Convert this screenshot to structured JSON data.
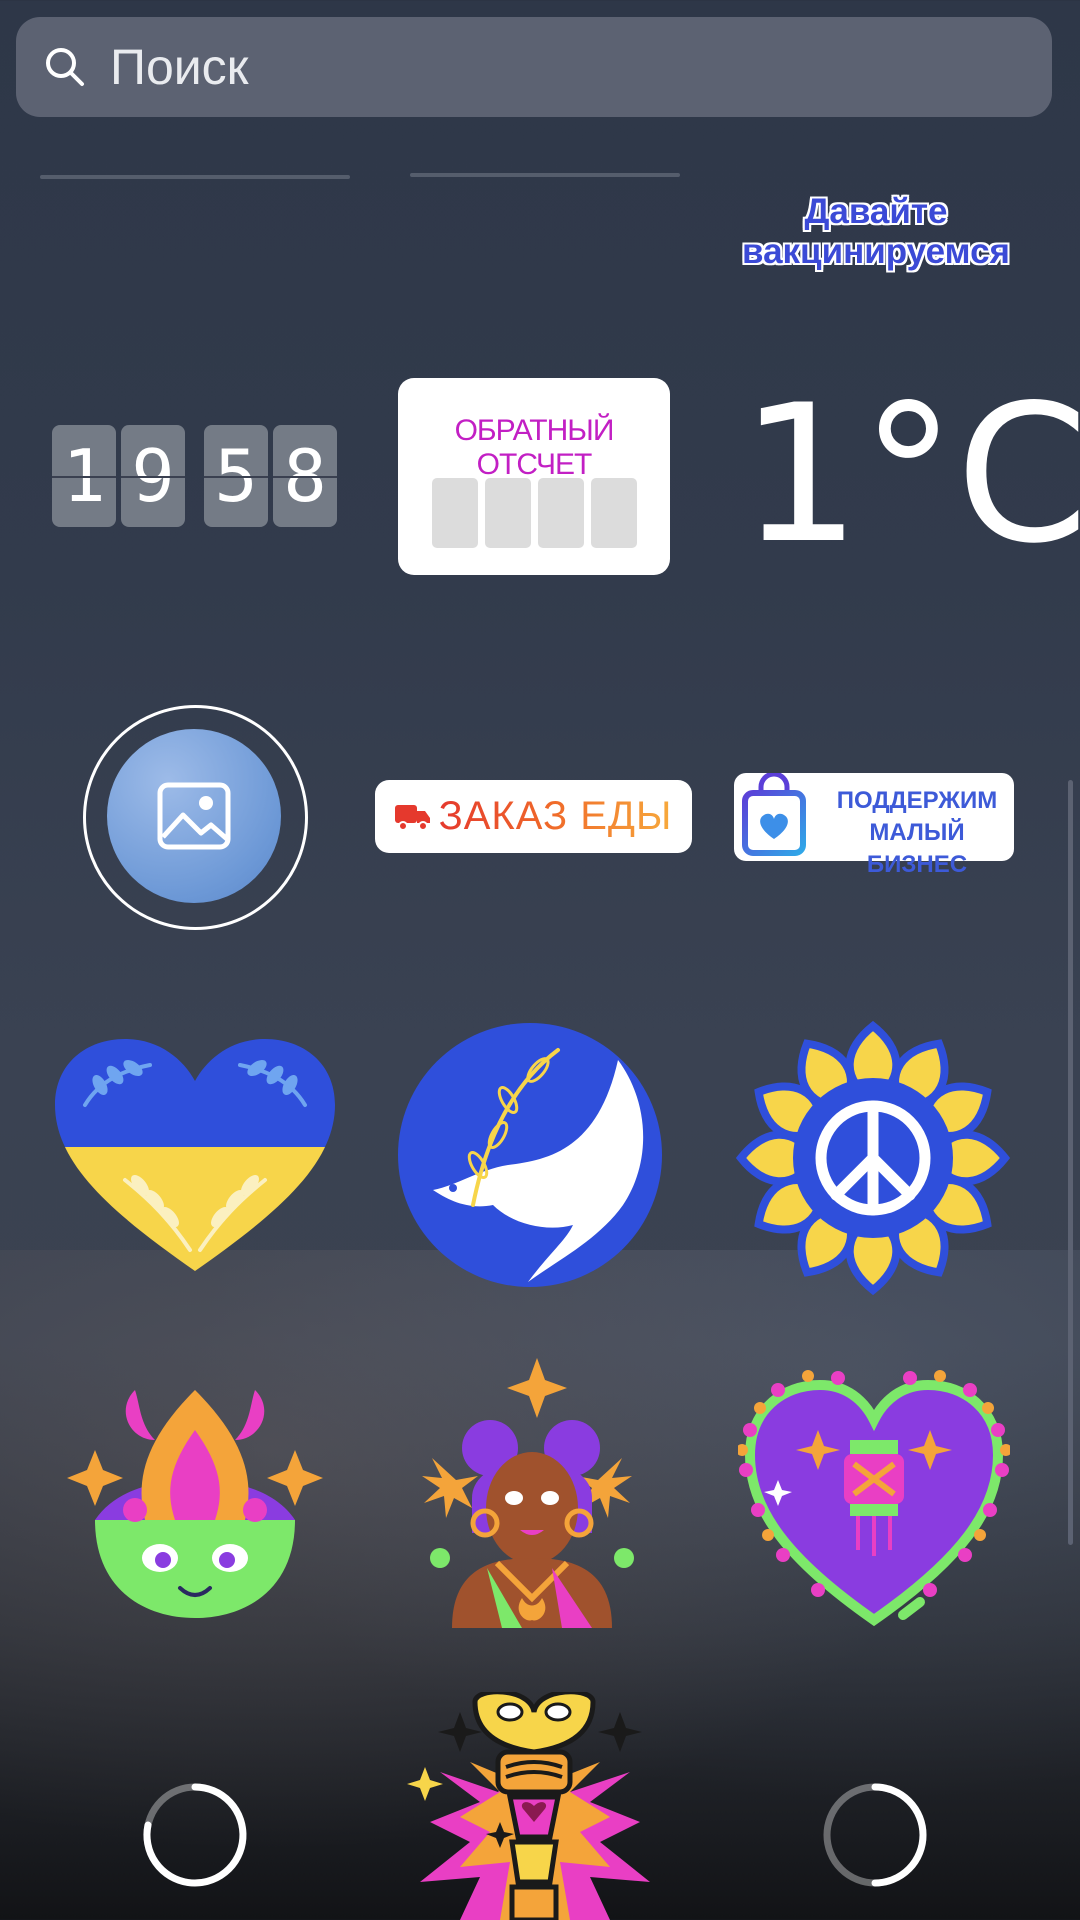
{
  "search": {
    "placeholder": "Поиск",
    "icon": "search-icon"
  },
  "stickers": {
    "vaccine_text": "Давайте вакцинируемся",
    "flip_clock": {
      "digits": [
        "1",
        "9",
        "5",
        "8"
      ]
    },
    "countdown": {
      "title": "ОБРАТНЫЙ ОТСЧЕТ"
    },
    "temperature": "1°C",
    "food_order": "ЗАКАЗ ЕДЫ",
    "small_business": {
      "line1": "ПОДДЕРЖИМ",
      "line2": "МАЛЫЙ БИЗНЕС"
    },
    "icons": [
      "photo-icon",
      "ukraine-heart-icon",
      "dove-icon",
      "peace-flower-icon",
      "diwali-flame-icon",
      "diwali-woman-icon",
      "diwali-lantern-heart-icon",
      "totem-icon"
    ]
  },
  "colors": {
    "background": "#323b4c",
    "search_bg": "#5c6272",
    "ukraine_blue": "#2f4fdb",
    "ukraine_yellow": "#f7d54a",
    "countdown_title": "#c21fc4"
  }
}
